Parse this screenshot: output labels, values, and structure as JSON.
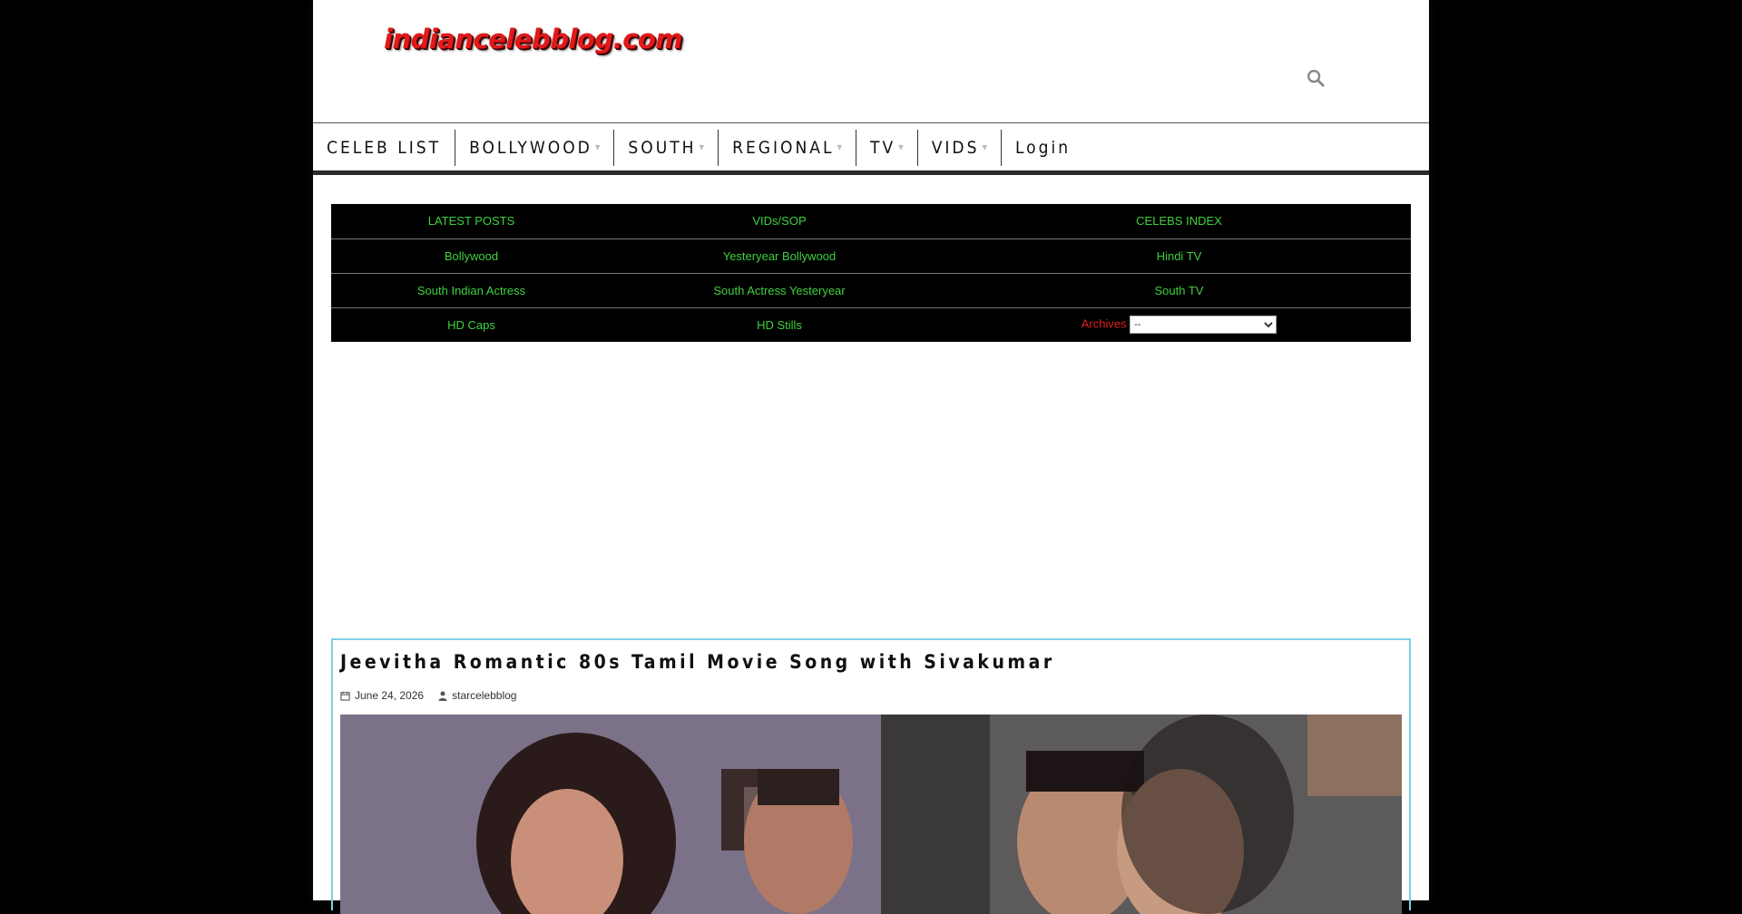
{
  "site": {
    "logo_text": "indiancelebblog.com"
  },
  "nav": {
    "items": [
      {
        "label": "CELEB LIST",
        "has_submenu": false
      },
      {
        "label": "BOLLYWOOD",
        "has_submenu": true
      },
      {
        "label": "SOUTH",
        "has_submenu": true
      },
      {
        "label": "REGIONAL",
        "has_submenu": true
      },
      {
        "label": "TV",
        "has_submenu": true
      },
      {
        "label": "VIDS",
        "has_submenu": true
      },
      {
        "label": "Login",
        "has_submenu": false
      }
    ]
  },
  "menu_table": {
    "rows": [
      [
        "LATEST POSTS",
        "VIDs/SOP",
        "CELEBS INDEX"
      ],
      [
        "Bollywood",
        "Yesteryear Bollywood",
        "Hindi TV"
      ],
      [
        "South Indian Actress",
        "South Actress Yesteryear",
        "South TV"
      ],
      [
        "HD Caps",
        "HD Stills",
        ""
      ]
    ],
    "archives_label": "Archives",
    "archives_selected": "--"
  },
  "post": {
    "title": "Jeevitha Romantic 80s Tamil Movie Song with Sivakumar",
    "date": "June 24, 2026",
    "author": "starcelebblog"
  },
  "colors": {
    "background": "#000000",
    "link_green": "#3fd13f",
    "archives_red": "#e02020",
    "post_border": "#7ed0e6",
    "logo_red": "#e01a1a"
  }
}
